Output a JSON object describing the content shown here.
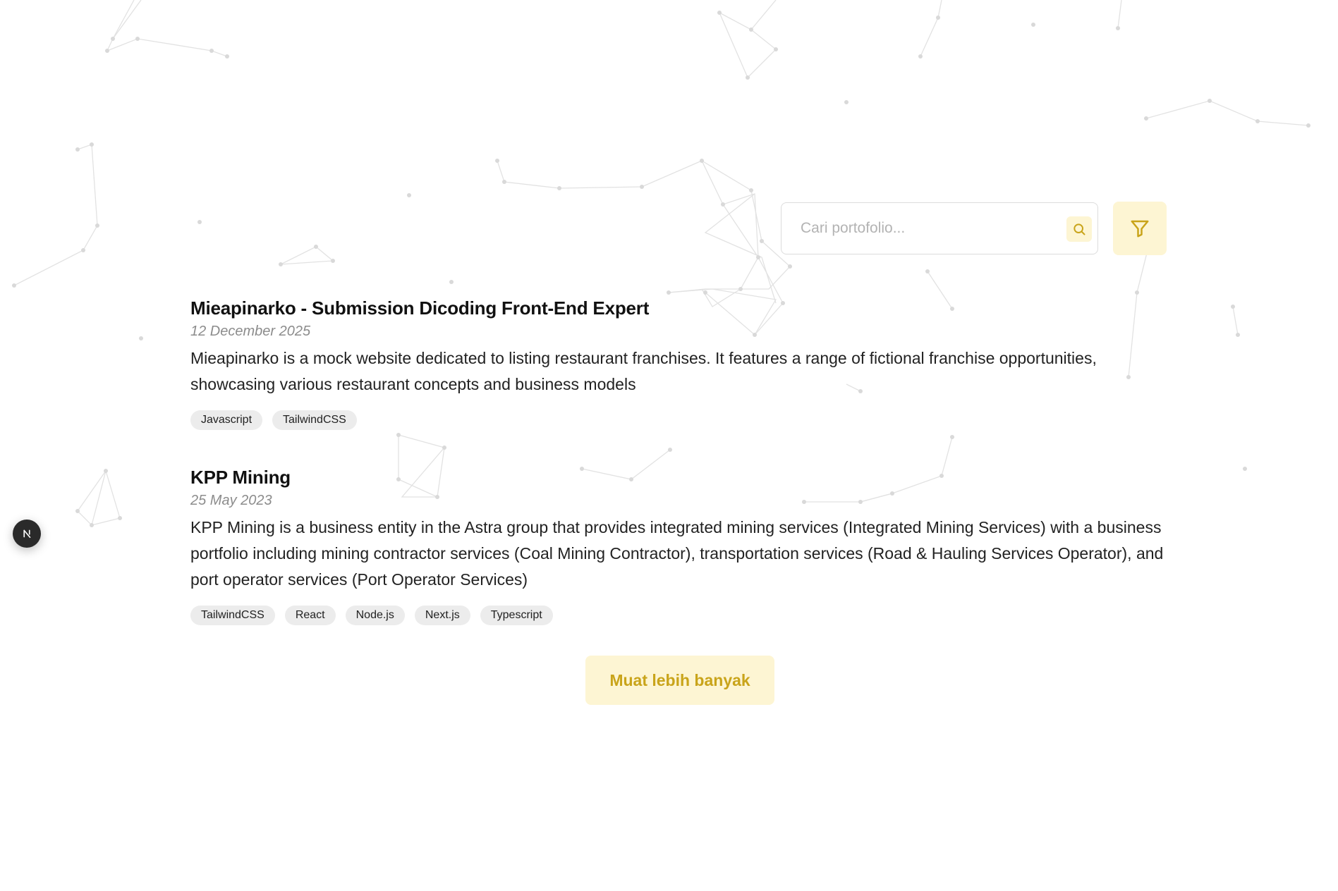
{
  "search": {
    "placeholder": "Cari portofolio..."
  },
  "icons": {
    "search": "search-icon",
    "filter": "filter-icon",
    "dev_badge": "nextjs-icon"
  },
  "colors": {
    "accent": "#c9a41a",
    "accent_bg": "#fdf5d3",
    "tag_bg": "#ececec",
    "date": "#8c8c8c"
  },
  "portfolio": {
    "items": [
      {
        "title": "Mieapinarko - Submission Dicoding Front-End Expert",
        "date": "12 December 2025",
        "description": "Mieapinarko is a mock website dedicated to listing restaurant franchises. It features a range of fictional franchise opportunities, showcasing various restaurant concepts and business models",
        "tags": [
          "Javascript",
          "TailwindCSS"
        ]
      },
      {
        "title": "KPP Mining",
        "date": "25 May 2023",
        "description": "KPP Mining is a business entity in the Astra group that provides integrated mining services (Integrated Mining Services) with a business portfolio including mining contractor services (Coal Mining Contractor), transportation services (Road & Hauling Services Operator), and port operator services (Port Operator Services)",
        "tags": [
          "TailwindCSS",
          "React",
          "Node.js",
          "Next.js",
          "Typescript"
        ]
      }
    ]
  },
  "load_more": {
    "label": "Muat lebih banyak"
  },
  "dev_badge": {
    "label": "N"
  }
}
